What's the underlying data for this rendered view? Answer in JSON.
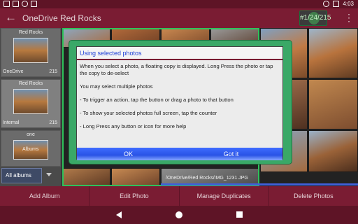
{
  "status_bar": {
    "time": "4:03"
  },
  "app_bar": {
    "back_icon": "arrow-left-icon",
    "title": "OneDrive Red Rocks",
    "counter": "#1/24/215",
    "overflow_icon": "more-vert-icon"
  },
  "sidebar": {
    "albums": [
      {
        "name": "Red Rocks",
        "location": "OneDrive",
        "count": "215"
      },
      {
        "name": "Red Rocks",
        "location": "Internal",
        "count": "215"
      },
      {
        "name": "one",
        "location": "",
        "count": "",
        "thumb_label": "Albums"
      }
    ],
    "all_albums_label": "All albums"
  },
  "grid": {
    "caption": "/OneDrive/Red Rocks/IMG_1231.JPG"
  },
  "dialog": {
    "title": "Using selected photos",
    "body": [
      "When you select a photo, a floating copy is displayed. Long Press the photo or tap the copy to de-select",
      "You may select multiple photos",
      "- To trigger an action, tap the button or drag a photo to that button",
      "- To show your selected photos full screen, tap the counter",
      "- Long Press any button or icon for more help"
    ],
    "ok_label": "OK",
    "got_it_label": "Got it"
  },
  "actions": [
    "Add Album",
    "Edit Photo",
    "Manage Duplicates",
    "Delete Photos"
  ],
  "colors": {
    "app_bar": "#7a1c33",
    "status_bar": "#5e1426",
    "dialog_frame": "#3aa867",
    "dialog_title": "#1c3fd6",
    "dialog_buttons": "#2a53e6"
  }
}
